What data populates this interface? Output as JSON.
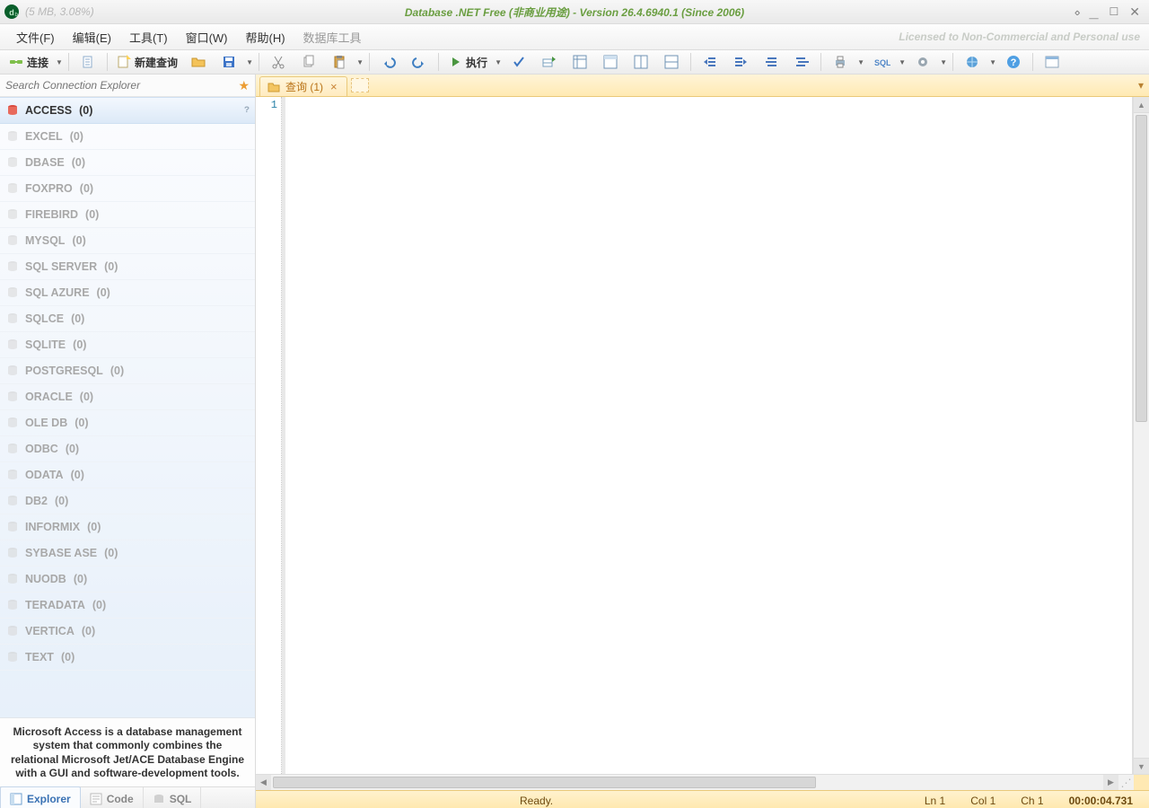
{
  "titlebar": {
    "mem": "(5 MB, 3.08%)",
    "main": "Database .NET Free (非商业用途)  -  Version 26.4.6940.1 (Since 2006)"
  },
  "menus": {
    "file": "文件(F)",
    "edit": "编辑(E)",
    "tools": "工具(T)",
    "window": "窗口(W)",
    "help": "帮助(H)",
    "dbtools": "数据库工具",
    "license": "Licensed to Non-Commercial and Personal use"
  },
  "toolbar": {
    "connect": "连接",
    "newquery": "新建查询",
    "execute": "执行"
  },
  "sidebar": {
    "search_placeholder": "Search Connection Explorer",
    "items": [
      {
        "name": "ACCESS",
        "count": "(0)",
        "selected": true
      },
      {
        "name": "EXCEL",
        "count": "(0)"
      },
      {
        "name": "DBASE",
        "count": "(0)"
      },
      {
        "name": "FOXPRO",
        "count": "(0)"
      },
      {
        "name": "FIREBIRD",
        "count": "(0)"
      },
      {
        "name": "MYSQL",
        "count": "(0)"
      },
      {
        "name": "SQL SERVER",
        "count": "(0)"
      },
      {
        "name": "SQL AZURE",
        "count": "(0)"
      },
      {
        "name": "SQLCE",
        "count": "(0)"
      },
      {
        "name": "SQLITE",
        "count": "(0)"
      },
      {
        "name": "POSTGRESQL",
        "count": "(0)"
      },
      {
        "name": "ORACLE",
        "count": "(0)"
      },
      {
        "name": "OLE DB",
        "count": "(0)"
      },
      {
        "name": "ODBC",
        "count": "(0)"
      },
      {
        "name": "ODATA",
        "count": "(0)"
      },
      {
        "name": "DB2",
        "count": "(0)"
      },
      {
        "name": "INFORMIX",
        "count": "(0)"
      },
      {
        "name": "SYBASE ASE",
        "count": "(0)"
      },
      {
        "name": "NUODB",
        "count": "(0)"
      },
      {
        "name": "TERADATA",
        "count": "(0)"
      },
      {
        "name": "VERTICA",
        "count": "(0)"
      },
      {
        "name": "TEXT",
        "count": "(0)"
      }
    ],
    "description": "Microsoft Access is a database management system that commonly combines the relational Microsoft Jet/ACE Database Engine with a GUI and software-development tools.",
    "tabs": {
      "explorer": "Explorer",
      "code": "Code",
      "sql": "SQL"
    }
  },
  "editor": {
    "tab_label": "查询 (1)",
    "first_line": "1"
  },
  "status": {
    "ready": "Ready.",
    "ln": "Ln 1",
    "col": "Col 1",
    "ch": "Ch 1",
    "time": "00:00:04.731"
  }
}
